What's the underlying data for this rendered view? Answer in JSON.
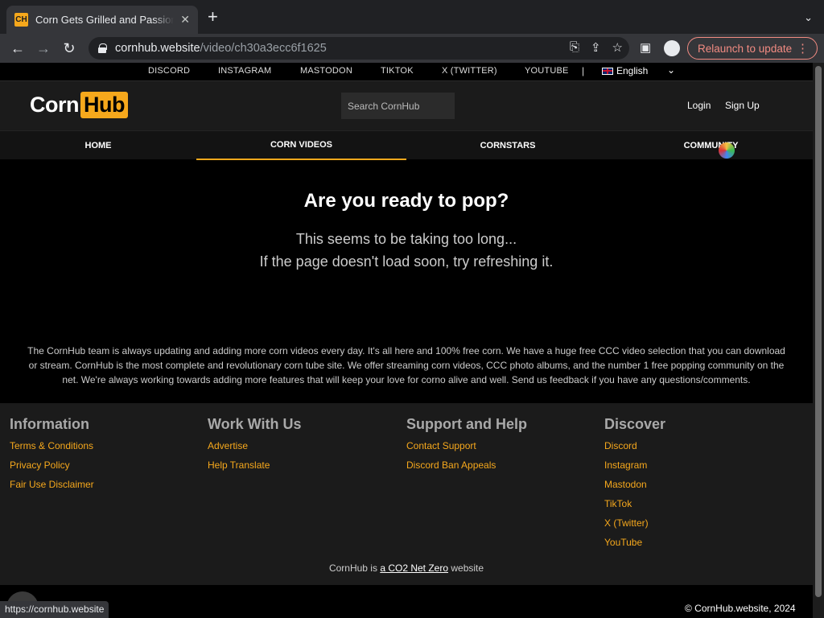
{
  "browser": {
    "tab_title": "Corn Gets Grilled and Passionate",
    "favicon_text": "CH",
    "url_host": "cornhub.website",
    "url_path": "/video/ch30a3ecc6f1625",
    "relaunch_label": "Relaunch to update",
    "status_url": "https://cornhub.website"
  },
  "social": {
    "links": [
      "DISCORD",
      "INSTAGRAM",
      "MASTODON",
      "TIKTOK",
      "X (TWITTER)",
      "YOUTUBE"
    ],
    "separator": "|",
    "language": "English"
  },
  "header": {
    "logo_corn": "Corn",
    "logo_hub": "Hub",
    "search_placeholder": "Search CornHub",
    "login": "Login",
    "signup": "Sign Up"
  },
  "nav": {
    "items": [
      "HOME",
      "CORN VIDEOS",
      "CORNSTARS",
      "COMMUNITY"
    ],
    "active": "CORN VIDEOS"
  },
  "main": {
    "title": "Are you ready to pop?",
    "line1": "This seems to be taking too long...",
    "line2": "If the page doesn't load soon, try refreshing it.",
    "about": "The CornHub team is always updating and adding more corn videos every day. It's all here and 100% free corn. We have a huge free CCC video selection that you can download or stream. CornHub is the most complete and revolutionary corn tube site. We offer streaming corn videos, CCC photo albums, and the number 1 free popping community on the net. We're always working towards adding more features that will keep your love for corno alive and well. Send us feedback if you have any questions/comments."
  },
  "footer": {
    "columns": [
      {
        "heading": "Information",
        "links": [
          "Terms & Conditions",
          "Privacy Policy",
          "Fair Use Disclaimer"
        ]
      },
      {
        "heading": "Work With Us",
        "links": [
          "Advertise",
          "Help Translate"
        ]
      },
      {
        "heading": "Support and Help",
        "links": [
          "Contact Support",
          "Discord Ban Appeals"
        ]
      },
      {
        "heading": "Discover",
        "links": [
          "Discord",
          "Instagram",
          "Mastodon",
          "TikTok",
          "X (Twitter)",
          "YouTube"
        ]
      }
    ],
    "co2_prefix": "CornHub is ",
    "co2_link": "a CO2 Net Zero",
    "co2_suffix": " website",
    "copyright": "© CornHub.website, 2024"
  },
  "colors": {
    "accent": "#f6a81c",
    "header_bg": "#1b1b1b",
    "page_bg": "#000000",
    "relaunch": "#f28b82"
  }
}
